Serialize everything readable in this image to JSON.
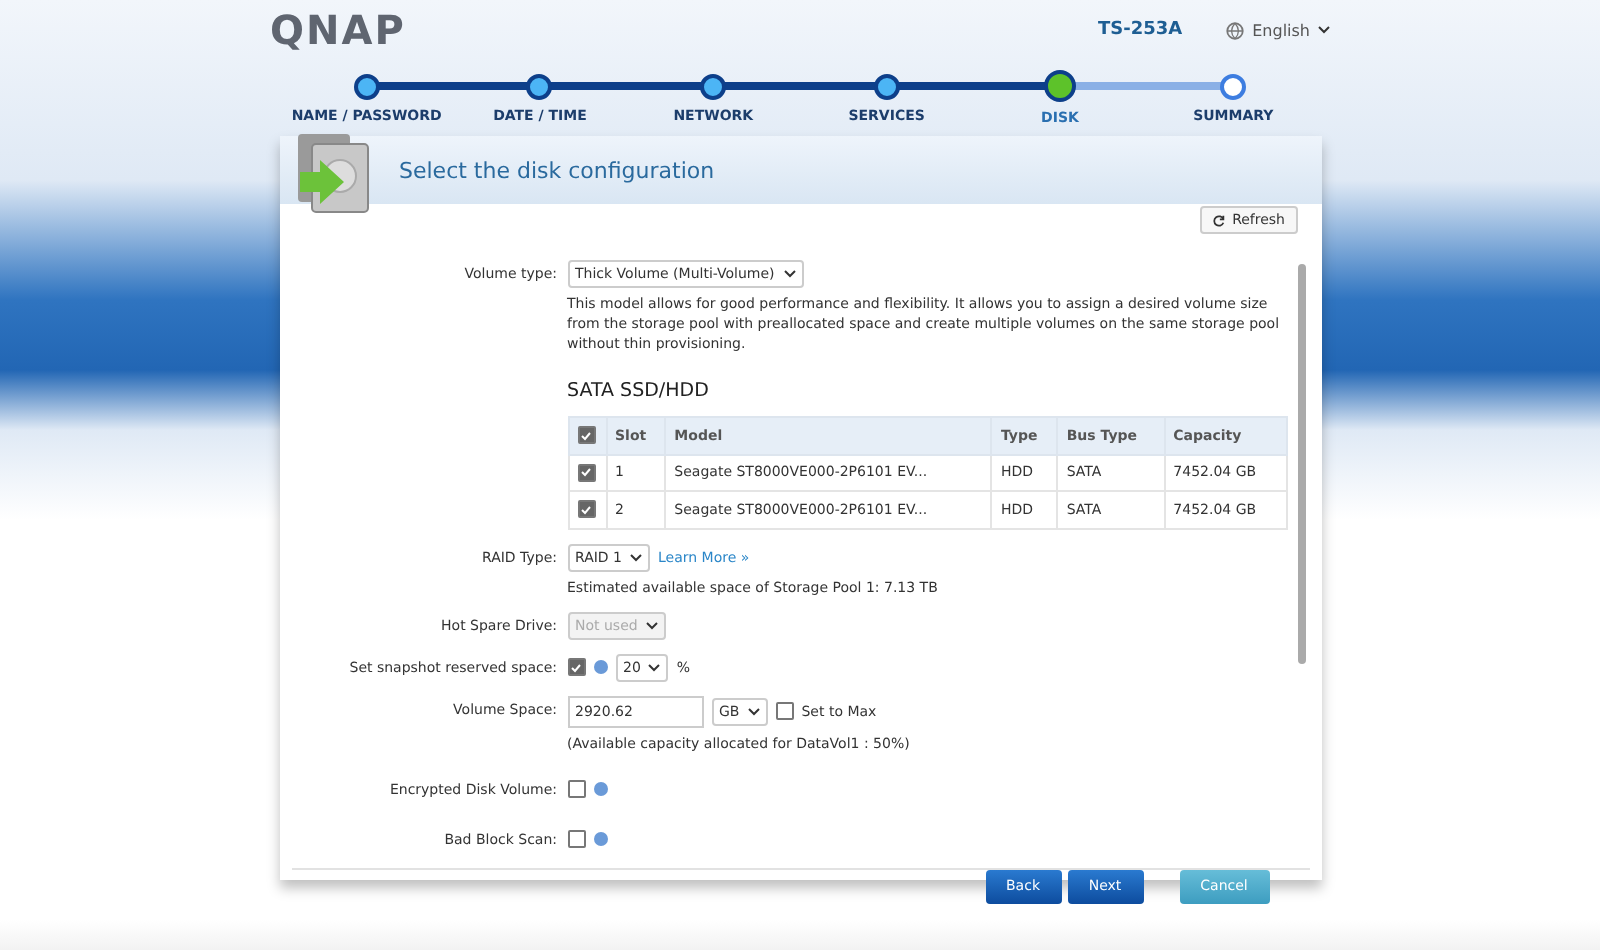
{
  "header": {
    "logo": "QNAP",
    "model": "TS-253A",
    "language": "English"
  },
  "steps": [
    {
      "label": "NAME / PASSWORD",
      "kind": "done"
    },
    {
      "label": "DATE / TIME",
      "kind": "done"
    },
    {
      "label": "NETWORK",
      "kind": "done"
    },
    {
      "label": "SERVICES",
      "kind": "done"
    },
    {
      "label": "DISK",
      "kind": "current"
    },
    {
      "label": "SUMMARY",
      "kind": "pending"
    }
  ],
  "panel": {
    "title": "Select the disk configuration",
    "refresh": "Refresh"
  },
  "volume_type": {
    "label": "Volume type:",
    "value": "Thick Volume (Multi-Volume)",
    "description": "This model allows for good performance and flexibility. It allows you to assign a desired volume size from the storage pool with preallocated space and create multiple volumes on the same storage pool without thin provisioning."
  },
  "disks": {
    "title": "SATA SSD/HDD",
    "all_checked": true,
    "columns": [
      "Slot",
      "Model",
      "Type",
      "Bus Type",
      "Capacity"
    ],
    "rows": [
      {
        "checked": true,
        "cells": [
          "1",
          "Seagate ST8000VE000-2P6101 EV...",
          "HDD",
          "SATA",
          "7452.04 GB"
        ]
      },
      {
        "checked": true,
        "cells": [
          "2",
          "Seagate ST8000VE000-2P6101 EV...",
          "HDD",
          "SATA",
          "7452.04 GB"
        ]
      }
    ]
  },
  "raid": {
    "label": "RAID Type:",
    "value": "RAID 1",
    "link": "Learn More »",
    "estimate": "Estimated available space of Storage Pool 1: 7.13 TB"
  },
  "hot_spare": {
    "label": "Hot Spare Drive:",
    "value": "Not used",
    "disabled": true
  },
  "snapshot": {
    "label": "Set snapshot reserved space:",
    "checked": true,
    "value": "20",
    "unit": "%"
  },
  "volume_space": {
    "label": "Volume Space:",
    "value": "2920.62",
    "unit": "GB",
    "max_label": "Set to Max",
    "max_checked": false,
    "note": "(Available capacity allocated for DataVol1 : 50%)"
  },
  "encrypted": {
    "label": "Encrypted Disk Volume:",
    "checked": false
  },
  "bad_block": {
    "label": "Bad Block Scan:",
    "checked": false
  },
  "buttons": [
    {
      "label": "Back",
      "kind": "primary"
    },
    {
      "label": "Next",
      "kind": "primary"
    },
    {
      "label": "Cancel",
      "kind": "secondary"
    }
  ]
}
